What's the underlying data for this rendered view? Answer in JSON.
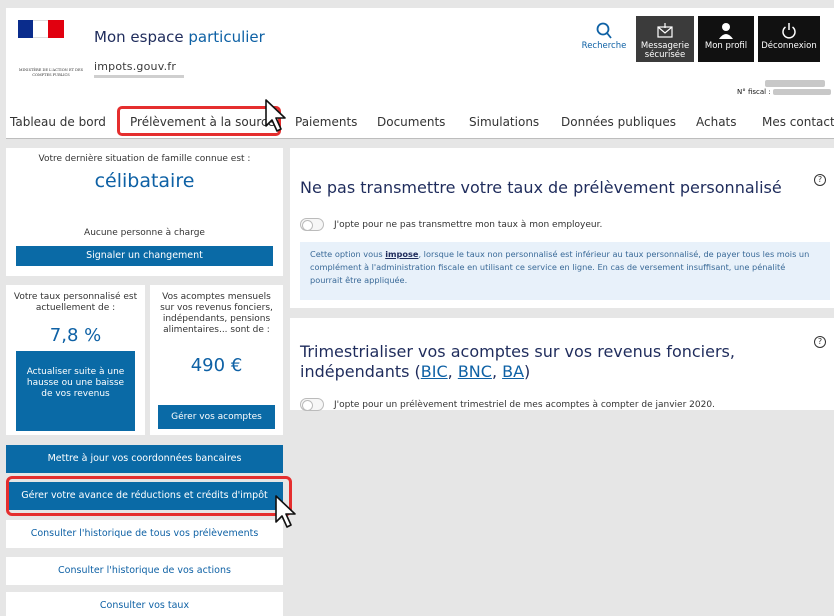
{
  "header": {
    "title_main": "Mon espace ",
    "title_accent": "particulier",
    "brand": "impots.gouv.fr",
    "logo_text": "MINISTÈRE DE L'ACTION ET DES COMPTES PUBLICS",
    "tools": [
      {
        "label": "Recherche",
        "icon": "search-icon"
      },
      {
        "label": "Messagerie sécurisée",
        "icon": "mail-icon"
      },
      {
        "label": "Mon profil",
        "icon": "user-icon"
      },
      {
        "label": "Déconnexion",
        "icon": "power-icon"
      }
    ],
    "fiscal_label": "N° fiscal :"
  },
  "nav": {
    "items": [
      "Tableau de bord",
      "Prélèvement à la source",
      "Paiements",
      "Documents",
      "Simulations",
      "Données publiques",
      "Achats",
      "Mes contacts"
    ]
  },
  "sidebar": {
    "family": {
      "intro": "Votre dernière situation de famille connue est :",
      "status": "célibataire",
      "dependents": "Aucune personne à charge",
      "button": "Signaler un changement"
    },
    "rate": {
      "label": "Votre taux personnalisé est actuellement de :",
      "value": "7,8 %",
      "button": "Actualiser suite à une hausse ou une baisse de vos revenus"
    },
    "installments": {
      "label": "Vos acomptes mensuels sur vos revenus fonciers, indépendants, pensions alimentaires... sont de :",
      "value": "490 €",
      "button": "Gérer vos acomptes"
    },
    "actions": [
      "Mettre à jour vos coordonnées bancaires",
      "Gérer votre avance de réductions et crédits d'impôt",
      "Consulter l'historique de tous vos prélèvements",
      "Consulter l'historique de vos actions",
      "Consulter vos taux"
    ]
  },
  "panels": {
    "p1": {
      "title": "Ne pas transmettre votre taux de prélèvement personnalisé",
      "toggle_label": "J'opte pour ne pas transmettre mon taux à mon employeur.",
      "info_before": "Cette option vous ",
      "info_bold": "impose",
      "info_after": ", lorsque le taux non personnalisé est inférieur au taux personnalisé, de payer tous les mois un complément à l'administration fiscale en utilisant ce service en ligne. En cas de versement insuffisant, une pénalité pourrait être appliquée.",
      "help": "?"
    },
    "p2": {
      "title_before": "Trimestrialiser vos acomptes sur vos revenus fonciers, indépendants (",
      "link1": "BIC",
      "sep1": ", ",
      "link2": "BNC",
      "sep2": ", ",
      "link3": "BA",
      "title_after": ")",
      "toggle_label": "J'opte pour un prélèvement trimestriel de mes acomptes à compter de janvier 2020.",
      "help": "?"
    }
  },
  "colors": {
    "accent_blue": "#0a6aa6",
    "title_navy": "#1f2c5c",
    "highlight_red": "#e52e2e"
  }
}
